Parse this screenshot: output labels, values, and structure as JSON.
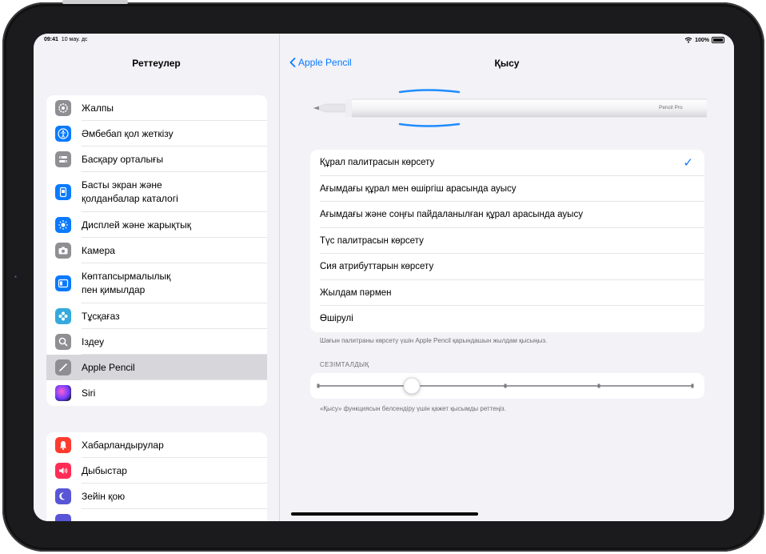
{
  "status": {
    "time": "09:41",
    "date": "10 мау. дс",
    "battery": "100%"
  },
  "sidebar": {
    "title": "Реттеулер",
    "group1": [
      {
        "label": "Жалпы",
        "icon": "gear-icon",
        "color": "#8e8e93"
      },
      {
        "label": "Әмбебап қол жеткізу",
        "icon": "accessibility-icon",
        "color": "#0a7aff"
      },
      {
        "label": "Басқару орталығы",
        "icon": "control-center-icon",
        "color": "#8e8e93"
      },
      {
        "label": "Басты экран және қолданбалар каталогі",
        "icon": "home-screen-icon",
        "color": "#0a7aff"
      },
      {
        "label": "Дисплей және жарықтық",
        "icon": "brightness-icon",
        "color": "#0a7aff"
      },
      {
        "label": "Камера",
        "icon": "camera-icon",
        "color": "#8e8e93"
      },
      {
        "label": "Көптапсырмалылық пен қимылдар",
        "icon": "multitasking-icon",
        "color": "#0a7aff"
      },
      {
        "label": "Тұсқағаз",
        "icon": "wallpaper-icon",
        "color": "#34aadc"
      },
      {
        "label": "Іздеу",
        "icon": "search-icon",
        "color": "#8e8e93"
      },
      {
        "label": "Apple Pencil",
        "icon": "pencil-icon",
        "color": "#8e8e93"
      },
      {
        "label": "Siri",
        "icon": "siri-icon",
        "color": "#1c1c1e"
      }
    ],
    "group2": [
      {
        "label": "Хабарландырулар",
        "icon": "notifications-icon",
        "color": "#ff3b30"
      },
      {
        "label": "Дыбыстар",
        "icon": "sounds-icon",
        "color": "#ff2d55"
      },
      {
        "label": "Зейін қою",
        "icon": "focus-icon",
        "color": "#5856d6"
      }
    ]
  },
  "detail": {
    "back_label": "Apple Pencil",
    "title": "Қысу",
    "pencil_brand": "Pencil Pro",
    "options": [
      "Құрал палитрасын көрсету",
      "Ағымдағы құрал мен өшіргіш арасында ауысу",
      "Ағымдағы және соңғы пайдаланылған құрал арасында ауысу",
      "Түс палитрасын көрсету",
      "Сия атрибуттарын көрсету",
      "Жылдам пәрмен",
      "Өшірулі"
    ],
    "options_footer": "Шағын палитраны көрсету үшін Apple Pencil қарындашын жылдам қысыңыз.",
    "sensitivity_label": "СЕЗІМТАЛДЫҚ",
    "sensitivity_value": 0.25,
    "sensitivity_footer": "«Қысу» функциясын белсендіру үшін қажет қысымды реттеңіз."
  },
  "colors": {
    "accent": "#0a7aff",
    "selected_row": "#d6d6db"
  }
}
